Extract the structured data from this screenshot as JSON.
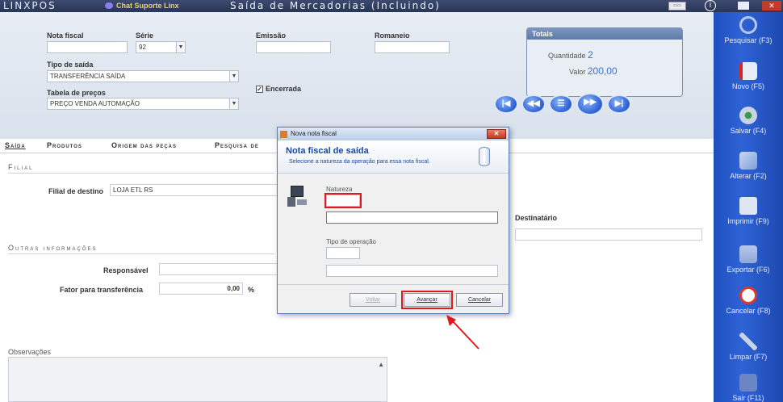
{
  "topbar": {
    "logo": "LINXPOS",
    "chat": "Chat Suporte Linx",
    "title": "Saída de Mercadorias (Incluindo)",
    "close_label": "✕"
  },
  "form": {
    "nota_fiscal_label": "Nota fiscal",
    "serie_label": "Série",
    "serie_value": "92",
    "emissao_label": "Emissão",
    "romaneio_label": "Romaneio",
    "tipo_saida_label": "Tipo de saída",
    "tipo_saida_value": "TRANSFERÊNCIA SAÍDA",
    "tabela_precos_label": "Tabela de preços",
    "tabela_precos_value": "PREÇO VENDA AUTOMAÇÃO",
    "encerrada_label": "Encerrada"
  },
  "totais": {
    "header": "Totais",
    "quantidade_label": "Quantidade",
    "quantidade_value": "2",
    "valor_label": "Valor",
    "valor_value": "200,00"
  },
  "tabs": [
    "Saída",
    "Produtos",
    "Origem das peças",
    "Pesquisa de"
  ],
  "filial": {
    "section": "Filial",
    "destino_label": "Filial de destino",
    "destino_value": "LOJA ETL RS",
    "destinatario_label": "Destinatário"
  },
  "outras": {
    "section": "Outras informações",
    "responsavel_label": "Responsável",
    "fator_label": "Fator para transferência",
    "fator_value": "0,00",
    "fator_unit": "%"
  },
  "observacoes_label": "Observações",
  "sidebar": [
    {
      "label": "Pesquisar (F3)",
      "icon": "search-icon",
      "color": "#b9c7e6"
    },
    {
      "label": "Novo (F5)",
      "icon": "new-document-icon",
      "color": "#e8ecf5"
    },
    {
      "label": "Salvar (F4)",
      "icon": "save-disc-icon",
      "color": "#c9d3e6"
    },
    {
      "label": "Alterar (F2)",
      "icon": "edit-icon",
      "color": "#7f9fd9"
    },
    {
      "label": "Imprimir (F9)",
      "icon": "printer-icon",
      "color": "#dfe5f2"
    },
    {
      "label": "Exportar (F6)",
      "icon": "export-icon",
      "color": "#8fa8d9"
    },
    {
      "label": "Cancelar (F8)",
      "icon": "cancel-icon",
      "color": "#e0382a"
    },
    {
      "label": "Limpar (F7)",
      "icon": "broom-icon",
      "color": "#c9d3e6"
    },
    {
      "label": "Sair (F11)",
      "icon": "exit-door-icon",
      "color": "#6b86c2"
    }
  ],
  "dialog": {
    "title": "Nova nota fiscal",
    "header": "Nota fiscal de saída",
    "subtitle": "Selecione a natureza da operação para essa nota fiscal.",
    "natureza_label": "Natureza",
    "tipo_operacao_label": "Tipo de operação",
    "voltar": "Voltar",
    "avancar": "Avançar",
    "cancelar": "Cancelar"
  }
}
